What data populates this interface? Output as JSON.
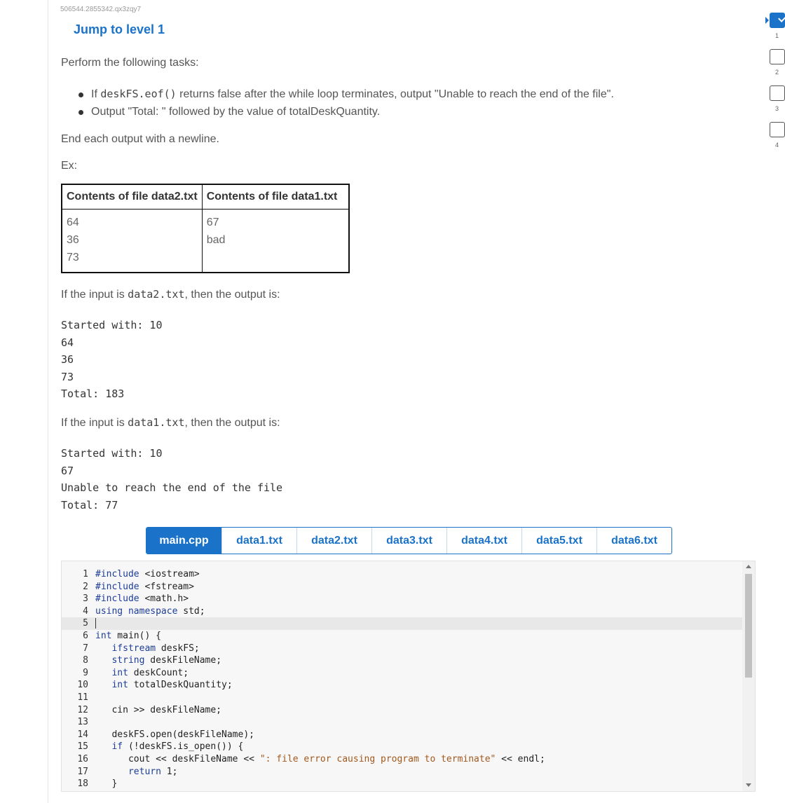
{
  "problem_id": "506544.2855342.qx3zqy7",
  "jump_link": "Jump to level 1",
  "intro": "Perform the following tasks:",
  "tasks": [
    {
      "pre": "If ",
      "code": "deskFS.eof()",
      "post": " returns false after the while loop terminates, output \"Unable to reach the end of the file\"."
    },
    {
      "pre": "Output \"Total: \" followed by the value of totalDeskQuantity.",
      "code": "",
      "post": ""
    }
  ],
  "end_note": "End each output with a newline.",
  "ex_label": "Ex:",
  "file_table": {
    "headers": [
      "Contents of file data2.txt",
      "Contents of file data1.txt"
    ],
    "col1": [
      "64",
      "36",
      "73"
    ],
    "col2": [
      "67",
      "bad"
    ]
  },
  "example1": {
    "pre": "If the input is ",
    "code": "data2.txt",
    "post": ", then the output is:"
  },
  "output1": [
    "Started with: 10",
    "64",
    "36",
    "73",
    "Total: 183"
  ],
  "example2": {
    "pre": "If the input is ",
    "code": "data1.txt",
    "post": ", then the output is:"
  },
  "output2": [
    "Started with: 10",
    "67",
    "Unable to reach the end of the file",
    "Total: 77"
  ],
  "tabs": [
    "main.cpp",
    "data1.txt",
    "data2.txt",
    "data3.txt",
    "data4.txt",
    "data5.txt",
    "data6.txt"
  ],
  "active_tab": "main.cpp",
  "code_lines": [
    "#include <iostream>",
    "#include <fstream>",
    "#include <math.h>",
    "using namespace std;",
    "",
    "int main() {",
    "   ifstream deskFS;",
    "   string deskFileName;",
    "   int deskCount;",
    "   int totalDeskQuantity;",
    "",
    "   cin >> deskFileName;",
    "",
    "   deskFS.open(deskFileName);",
    "   if (!deskFS.is_open()) {",
    "      cout << deskFileName << \": file error causing program to terminate\" << endl;",
    "      return 1;",
    "   }"
  ],
  "levels": [
    {
      "num": "1",
      "done": true
    },
    {
      "num": "2",
      "done": false
    },
    {
      "num": "3",
      "done": false
    },
    {
      "num": "4",
      "done": false
    }
  ],
  "colors": {
    "accent": "#1a73c8",
    "text": "#555555",
    "code_keyword": "#1d3d9a",
    "code_string": "#a3581b"
  }
}
